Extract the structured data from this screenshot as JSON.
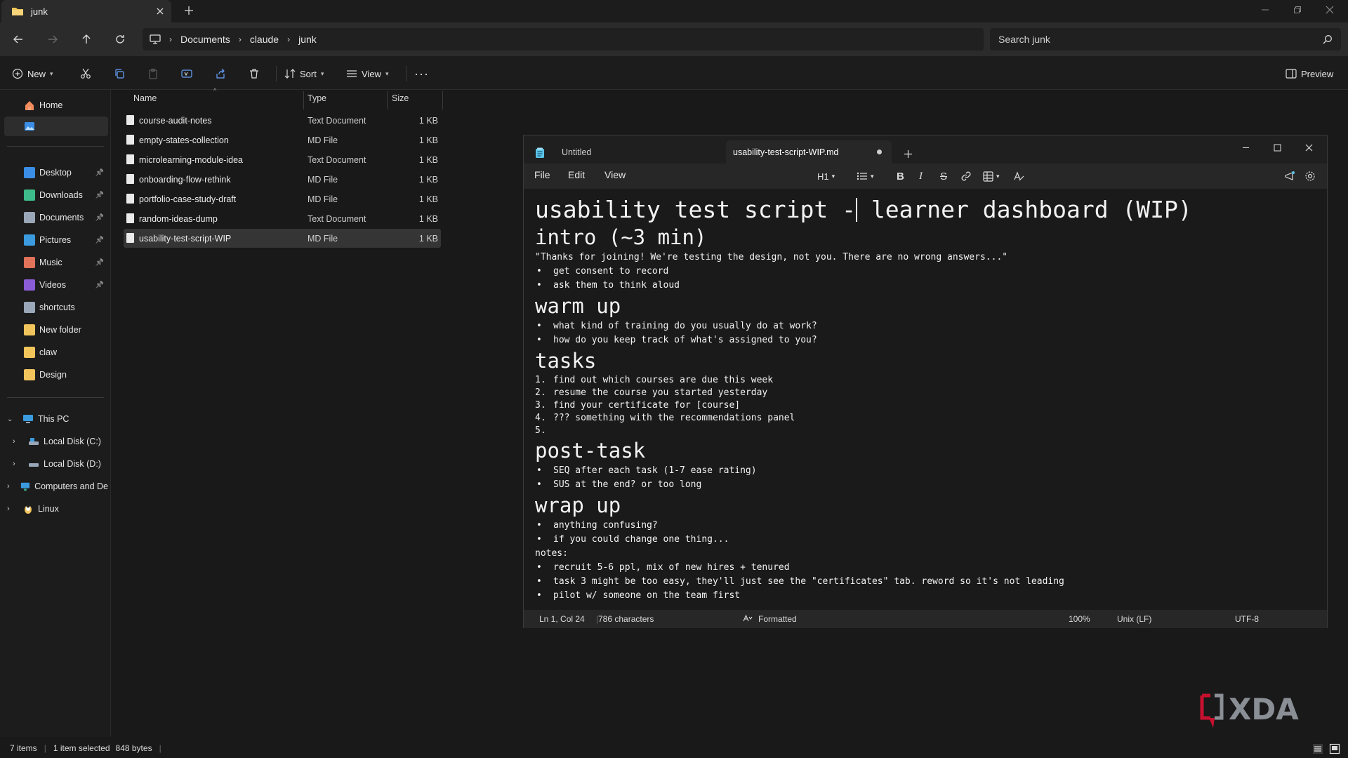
{
  "explorer": {
    "tab": {
      "title": "junk"
    },
    "address": {
      "path": [
        "Documents",
        "claude",
        "junk"
      ]
    },
    "search": {
      "placeholder": "Search junk"
    },
    "commands": {
      "new": "New",
      "sort": "Sort",
      "view": "View",
      "preview": "Preview"
    },
    "sidebar": {
      "home": "Home",
      "quick": [
        {
          "label": "Desktop",
          "icon": "desktop-icon",
          "color": "#3a8ee6"
        },
        {
          "label": "Downloads",
          "icon": "download-icon",
          "color": "#3dbb8a"
        },
        {
          "label": "Documents",
          "icon": "document-icon",
          "color": "#9aa7b8"
        },
        {
          "label": "Pictures",
          "icon": "pictures-icon",
          "color": "#3b9bde"
        },
        {
          "label": "Music",
          "icon": "music-icon",
          "color": "#e0735a"
        },
        {
          "label": "Videos",
          "icon": "videos-icon",
          "color": "#8a5cd6"
        },
        {
          "label": "shortcuts",
          "icon": "shortcuts-icon",
          "color": "#9aa7b8"
        },
        {
          "label": "New folder",
          "icon": "folder-icon",
          "color": "#f2c55c"
        },
        {
          "label": "claw",
          "icon": "folder-icon",
          "color": "#f2c55c"
        },
        {
          "label": "Design",
          "icon": "folder-icon",
          "color": "#f2c55c"
        }
      ],
      "tree": [
        {
          "label": "This PC",
          "icon": "pc-icon"
        },
        {
          "label": "Local Disk (C:)",
          "icon": "drive-icon"
        },
        {
          "label": "Local Disk (D:)",
          "icon": "drive-icon"
        },
        {
          "label": "Computers and De",
          "icon": "network-icon"
        },
        {
          "label": "Linux",
          "icon": "linux-icon"
        }
      ]
    },
    "columns": {
      "name": "Name",
      "type": "Type",
      "size": "Size"
    },
    "files": [
      {
        "name": "course-audit-notes",
        "type": "Text Document",
        "size": "1 KB"
      },
      {
        "name": "empty-states-collection",
        "type": "MD File",
        "size": "1 KB"
      },
      {
        "name": "microlearning-module-idea",
        "type": "Text Document",
        "size": "1 KB"
      },
      {
        "name": "onboarding-flow-rethink",
        "type": "MD File",
        "size": "1 KB"
      },
      {
        "name": "portfolio-case-study-draft",
        "type": "MD File",
        "size": "1 KB"
      },
      {
        "name": "random-ideas-dump",
        "type": "Text Document",
        "size": "1 KB"
      },
      {
        "name": "usability-test-script-WIP",
        "type": "MD File",
        "size": "1 KB",
        "selected": true
      }
    ],
    "status": {
      "items": "7 items",
      "selected": "1 item selected",
      "bytes": "848 bytes"
    }
  },
  "notepad": {
    "tabs": [
      "Untitled",
      "usability-test-script-WIP.md"
    ],
    "menu": [
      "File",
      "Edit",
      "View"
    ],
    "heading_level": "H1",
    "doc": {
      "title_before_cursor": "usability test script -",
      "title_after_cursor": " learner dashboard (WIP)",
      "intro": {
        "heading": "intro (~3 min)",
        "quote": "\"Thanks for joining! We're testing the design, not you. There are no wrong answers...\"",
        "items": [
          "get consent to record",
          "ask them to think aloud"
        ]
      },
      "warmup": {
        "heading": "warm up",
        "items": [
          "what kind of training do you usually do at work?",
          "how do you keep track of what's assigned to you?"
        ]
      },
      "tasks": {
        "heading": "tasks",
        "items": [
          {
            "n": "1.",
            "t": "find out which courses are due this week"
          },
          {
            "n": "2.",
            "t": "resume the course you started yesterday"
          },
          {
            "n": "3.",
            "t": "find your certificate for [course]"
          },
          {
            "n": "4.",
            "t": "??? something with the recommendations panel"
          },
          {
            "n": "5.",
            "t": ""
          }
        ]
      },
      "posttask": {
        "heading": "post-task",
        "items": [
          "SEQ after each task (1-7 ease rating)",
          "SUS at the end? or too long"
        ]
      },
      "wrapup": {
        "heading": "wrap up",
        "items": [
          "anything confusing?",
          "if you could change one thing..."
        ]
      },
      "notes": {
        "label": "notes:",
        "items": [
          "recruit 5-6 ppl, mix of new hires + tenured",
          "task 3 might be too easy, they'll just see the \"certificates\" tab. reword so it's not leading",
          "pilot w/ someone on the team first"
        ]
      }
    },
    "status": {
      "position": "Ln 1, Col 24",
      "chars": "786 characters",
      "format": "Formatted",
      "zoom": "100%",
      "eol": "Unix (LF)",
      "encoding": "UTF-8"
    }
  },
  "watermark": {
    "brand": "XDA",
    "accent": "#c8102e"
  }
}
